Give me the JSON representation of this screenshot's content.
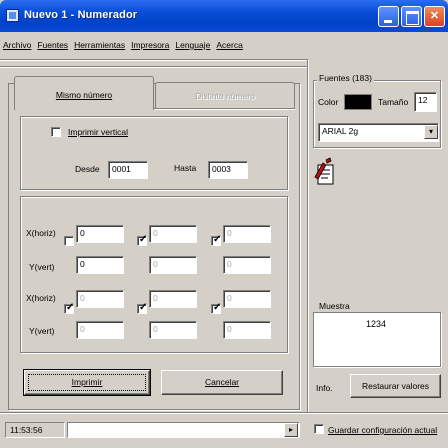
{
  "window": {
    "title": "Nuevo 1 - Numerador"
  },
  "menu": [
    "Archivo",
    "Fuentes",
    "Herramientas",
    "Impresora",
    "Lenguaje",
    "Acerca"
  ],
  "tabs": [
    {
      "label": "Mismo número",
      "active": true
    },
    {
      "label": "Distinto número",
      "active": false
    }
  ],
  "numbering": {
    "vertical_label": "Imprimir vertical",
    "vertical_checked": false,
    "from_label": "Desde",
    "from_value": "0001",
    "to_label": "Hasta",
    "to_value": "0003"
  },
  "positions": {
    "x_label": "X(horiz)",
    "y_label": "Y(vert)",
    "row1": {
      "checks": [
        false,
        true,
        true
      ],
      "x_values": [
        "0",
        "0",
        "0"
      ],
      "y_values": [
        "0",
        "0",
        "0"
      ]
    },
    "row2": {
      "checks": [
        true,
        true,
        true
      ],
      "x_values": [
        "0",
        "0",
        "0"
      ],
      "y_values": [
        "0",
        "0",
        "0"
      ]
    }
  },
  "buttons": {
    "print": "Imprimir",
    "cancel": "Cancelar",
    "info": "Info.",
    "restore": "Restaurar valores"
  },
  "fonts": {
    "group_label": "Fuentes (183)",
    "color_label": "Color",
    "color_value": "#000000",
    "size_label": "Tamaño",
    "size_value": "12",
    "font_name": "ARIAL 2g"
  },
  "sample": {
    "group_label": "Muestra",
    "text": "1234"
  },
  "status": {
    "time": "11:53:56",
    "save_config_label": "Guardar configuración actual",
    "save_config_checked": false
  }
}
